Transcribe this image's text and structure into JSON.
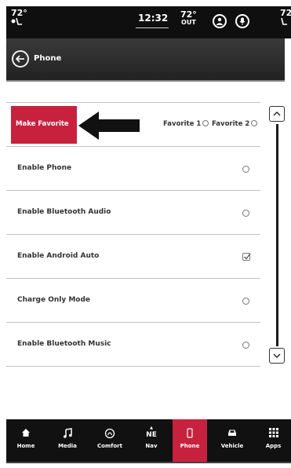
{
  "status_bar": {
    "left_temp": "72°",
    "time": "12:32",
    "outside_temp": "72°",
    "outside_label": "OUT",
    "right_temp": "72"
  },
  "header": {
    "title": "Phone"
  },
  "settings": {
    "favorite": {
      "label": "Make Favorite",
      "option1": "Favorite 1",
      "option2": "Favorite 2"
    },
    "rows": [
      {
        "label": "Enable Phone",
        "control": "radio",
        "checked": false
      },
      {
        "label": "Enable Bluetooth Audio",
        "control": "radio",
        "checked": false
      },
      {
        "label": "Enable Android Auto",
        "control": "checkbox",
        "checked": true
      },
      {
        "label": "Charge Only Mode",
        "control": "radio",
        "checked": false
      },
      {
        "label": "Enable Bluetooth Music",
        "control": "radio",
        "checked": false
      }
    ]
  },
  "nav": {
    "items": [
      {
        "label": "Home",
        "icon": "home-icon"
      },
      {
        "label": "Media",
        "icon": "music-note-icon"
      },
      {
        "label": "Comfort",
        "icon": "comfort-icon"
      },
      {
        "label": "Nav",
        "icon": "compass-icon",
        "direction": "NE"
      },
      {
        "label": "Phone",
        "icon": "phone-icon",
        "active": true
      },
      {
        "label": "Vehicle",
        "icon": "car-icon"
      },
      {
        "label": "Apps",
        "icon": "apps-grid-icon"
      }
    ]
  },
  "colors": {
    "accent": "#c8213e",
    "bar": "#111111"
  }
}
